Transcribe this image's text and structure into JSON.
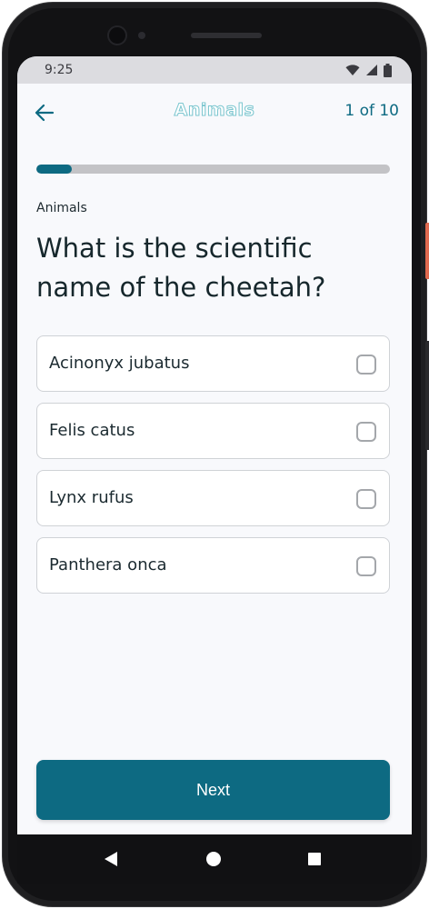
{
  "status_bar": {
    "time": "9:25",
    "icons": [
      "wifi-icon",
      "signal-icon",
      "battery-icon"
    ]
  },
  "app_bar": {
    "back_icon": "arrow-left-icon",
    "title": "Animals",
    "progress_text": "1 of 10"
  },
  "progress": {
    "current": 1,
    "total": 10,
    "fraction": 0.1
  },
  "category": "Animals",
  "question": "What is the scientific name of the cheetah?",
  "options": [
    {
      "label": "Acinonyx jubatus",
      "checked": false
    },
    {
      "label": "Felis catus",
      "checked": false
    },
    {
      "label": "Lynx rufus",
      "checked": false
    },
    {
      "label": "Panthera onca",
      "checked": false
    }
  ],
  "next_button": {
    "label": "Next"
  },
  "nav_bar": {
    "icons": [
      "triangle-back-icon",
      "circle-home-icon",
      "square-recents-icon"
    ]
  },
  "colors": {
    "primary": "#0d6a82",
    "title_outline": "#7cc6cf",
    "background": "#f8f9fc",
    "track": "#c3c3c6"
  }
}
